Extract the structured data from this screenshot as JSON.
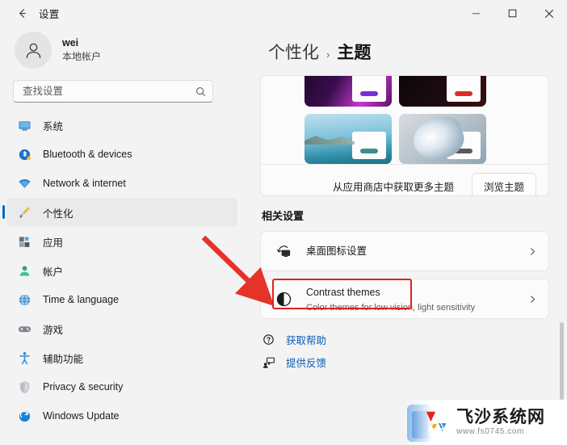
{
  "window": {
    "title": "设置",
    "back_icon": "back-arrow-icon",
    "controls": {
      "minimize": "—",
      "maximize": "□",
      "close": "✕"
    }
  },
  "sidebar": {
    "account": {
      "name": "wei",
      "type": "本地帐户",
      "avatar_icon": "person-avatar-icon"
    },
    "search": {
      "placeholder": "查找设置",
      "value": "",
      "icon": "search-icon"
    },
    "items": [
      {
        "label": "系统",
        "icon": "system-icon",
        "selected": false
      },
      {
        "label": "Bluetooth & devices",
        "icon": "bluetooth-icon",
        "selected": false
      },
      {
        "label": "Network & internet",
        "icon": "wifi-icon",
        "selected": false
      },
      {
        "label": "个性化",
        "icon": "personalization-brush-icon",
        "selected": true
      },
      {
        "label": "应用",
        "icon": "apps-icon",
        "selected": false
      },
      {
        "label": "帐户",
        "icon": "accounts-person-icon",
        "selected": false
      },
      {
        "label": "Time & language",
        "icon": "clock-globe-icon",
        "selected": false
      },
      {
        "label": "游戏",
        "icon": "gamepad-icon",
        "selected": false
      },
      {
        "label": "辅助功能",
        "icon": "accessibility-person-icon",
        "selected": false
      },
      {
        "label": "Privacy & security",
        "icon": "shield-icon",
        "selected": false
      },
      {
        "label": "Windows Update",
        "icon": "update-refresh-icon",
        "selected": false
      }
    ]
  },
  "content": {
    "breadcrumb": {
      "parent": "个性化",
      "separator": "›",
      "current": "主题"
    },
    "themes_card": {
      "thumbnails": [
        {
          "name": "theme-thumb-purple",
          "pill_color": "#7a2fd4"
        },
        {
          "name": "theme-thumb-dark-red",
          "pill_color": "#d93025"
        },
        {
          "name": "theme-thumb-lake",
          "pill_color": "#3b8f8a"
        },
        {
          "name": "theme-thumb-flow",
          "pill_color": "#555a5e"
        }
      ],
      "store_text": "从应用商店中获取更多主题",
      "browse_button": "浏览主题"
    },
    "related_settings": {
      "title": "相关设置",
      "rows": [
        {
          "title": "桌面图标设置",
          "subtitle": "",
          "icon": "desktop-icon-settings-icon",
          "chevron": "›",
          "highlighted": true
        },
        {
          "title": "Contrast themes",
          "subtitle": "Color themes for low vision, light sensitivity",
          "icon": "contrast-circle-icon",
          "chevron": "›",
          "highlighted": false
        }
      ]
    },
    "help_links": [
      {
        "label": "获取帮助",
        "icon": "help-question-icon"
      },
      {
        "label": "提供反馈",
        "icon": "feedback-speech-icon"
      }
    ]
  },
  "annotations": {
    "arrow_color": "#e63329",
    "highlight_color": "#e02020"
  },
  "watermark": {
    "name": "飞沙系统网",
    "url": "www.fs0745.com",
    "logo_icon": "fs-triangle-logo-icon"
  }
}
